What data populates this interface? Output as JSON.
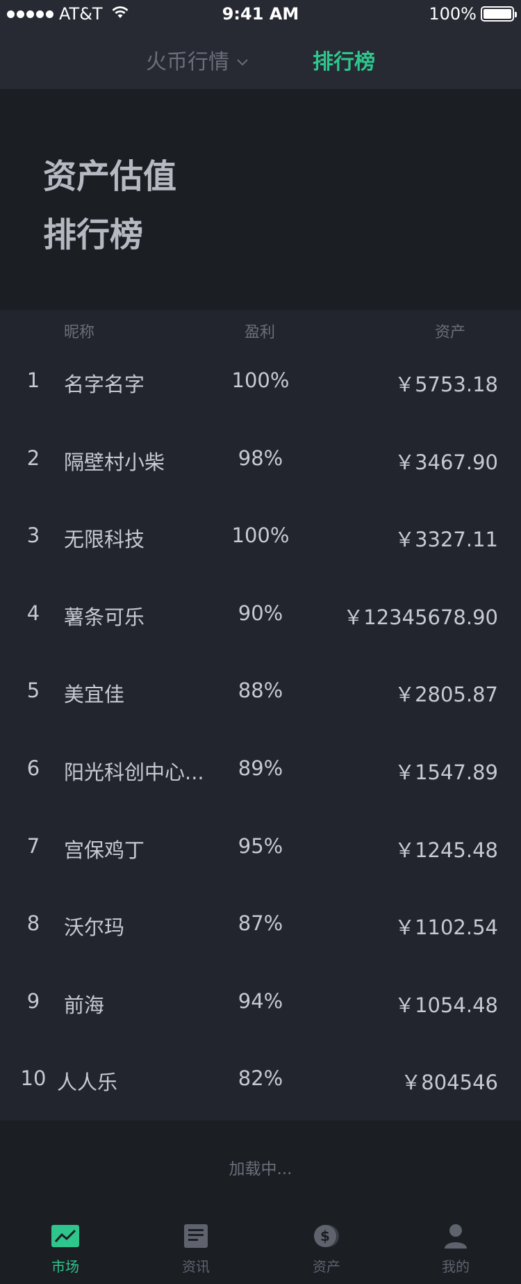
{
  "status_bar": {
    "carrier": "AT&T",
    "time": "9:41 AM",
    "battery": "100%"
  },
  "nav": {
    "market_tab": "火币行情",
    "rank_tab": "排行榜"
  },
  "hero": {
    "line1": "资产估值",
    "line2": "排行榜"
  },
  "table": {
    "headers": {
      "name": "昵称",
      "profit": "盈利",
      "asset": "资产"
    },
    "rows": [
      {
        "rank": "1",
        "name": "名字名字",
        "profit": "100%",
        "asset": "￥5753.18"
      },
      {
        "rank": "2",
        "name": "隔壁村小柴",
        "profit": "98%",
        "asset": "￥3467.90"
      },
      {
        "rank": "3",
        "name": "无限科技",
        "profit": "100%",
        "asset": "￥3327.11"
      },
      {
        "rank": "4",
        "name": "薯条可乐",
        "profit": "90%",
        "asset": "￥12345678.90"
      },
      {
        "rank": "5",
        "name": "美宜佳",
        "profit": "88%",
        "asset": "￥2805.87"
      },
      {
        "rank": "6",
        "name": "阳光科创中心...",
        "profit": "89%",
        "asset": "￥1547.89"
      },
      {
        "rank": "7",
        "name": "宫保鸡丁",
        "profit": "95%",
        "asset": "￥1245.48"
      },
      {
        "rank": "8",
        "name": "沃尔玛",
        "profit": "87%",
        "asset": "￥1102.54"
      },
      {
        "rank": "9",
        "name": "前海",
        "profit": "94%",
        "asset": "￥1054.48"
      },
      {
        "rank": "10",
        "name": "人人乐",
        "profit": "82%",
        "asset": "￥804546"
      }
    ]
  },
  "loading": "加载中...",
  "tab_bar": {
    "items": [
      {
        "label": "市场",
        "icon": "market-chart-icon"
      },
      {
        "label": "资讯",
        "icon": "news-icon"
      },
      {
        "label": "资产",
        "icon": "dollar-coin-icon"
      },
      {
        "label": "我的",
        "icon": "user-icon"
      }
    ]
  },
  "colors": {
    "accent": "#2ec68d",
    "background": "#22252d",
    "hero_background": "#1b1e23"
  }
}
